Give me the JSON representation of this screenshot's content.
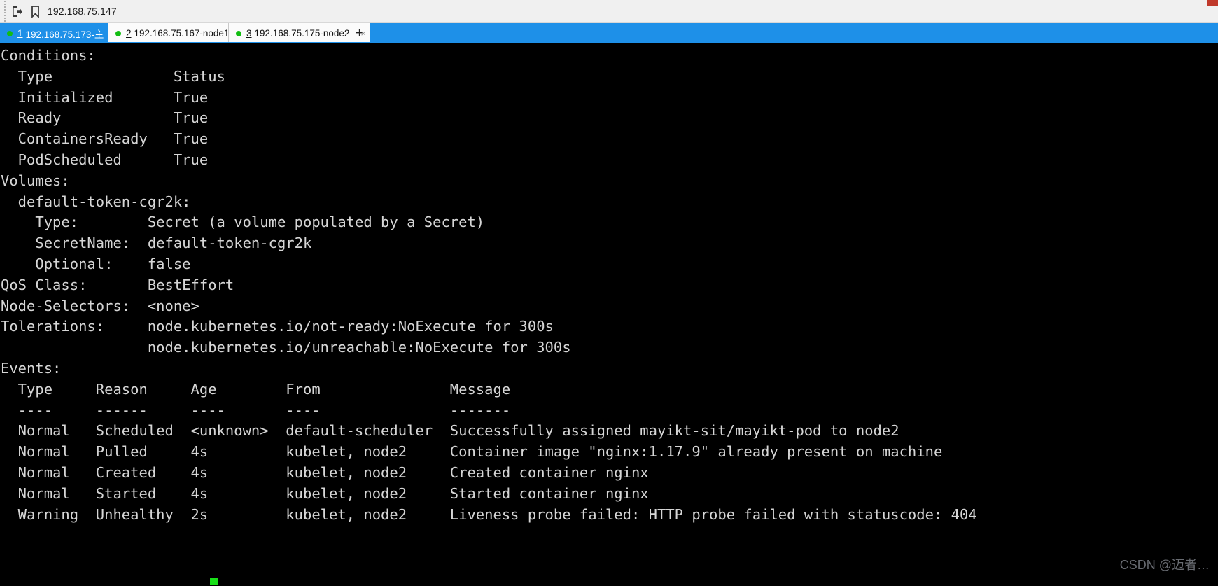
{
  "toolbar": {
    "icons": [
      "export-icon",
      "bookmark-icon"
    ],
    "address": "192.168.75.147"
  },
  "tabs": {
    "items": [
      {
        "index": "1",
        "label": "192.168.75.173-主",
        "status": "connected",
        "active": true,
        "close_label": "×"
      },
      {
        "index": "2",
        "label": "192.168.75.167-node1",
        "status": "connected",
        "active": false,
        "close_label": "×"
      },
      {
        "index": "3",
        "label": "192.168.75.175-node2",
        "status": "connected",
        "active": false,
        "close_label": "×"
      }
    ],
    "add_label": "+"
  },
  "terminal": {
    "lines": [
      "Conditions:",
      "  Type              Status",
      "  Initialized       True ",
      "  Ready             True ",
      "  ContainersReady   True ",
      "  PodScheduled      True ",
      "Volumes:",
      "  default-token-cgr2k:",
      "    Type:        Secret (a volume populated by a Secret)",
      "    SecretName:  default-token-cgr2k",
      "    Optional:    false",
      "QoS Class:       BestEffort",
      "Node-Selectors:  <none>",
      "Tolerations:     node.kubernetes.io/not-ready:NoExecute for 300s",
      "                 node.kubernetes.io/unreachable:NoExecute for 300s",
      "Events:",
      "  Type     Reason     Age        From               Message",
      "  ----     ------     ----       ----               -------",
      "  Normal   Scheduled  <unknown>  default-scheduler  Successfully assigned mayikt-sit/mayikt-pod to node2",
      "  Normal   Pulled     4s         kubelet, node2     Container image \"nginx:1.17.9\" already present on machine",
      "  Normal   Created    4s         kubelet, node2     Created container nginx",
      "  Normal   Started    4s         kubelet, node2     Started container nginx",
      "  Warning  Unhealthy  2s         kubelet, node2     Liveness probe failed: HTTP probe failed with statuscode: 404"
    ]
  },
  "watermark": {
    "text": "CSDN @迈者…"
  },
  "colors": {
    "terminal_bg": "#000000",
    "terminal_fg": "#d6d6d6",
    "tab_active_bg": "#1e90e8",
    "status_dot": "#12bd12",
    "cursor": "#19e019"
  }
}
